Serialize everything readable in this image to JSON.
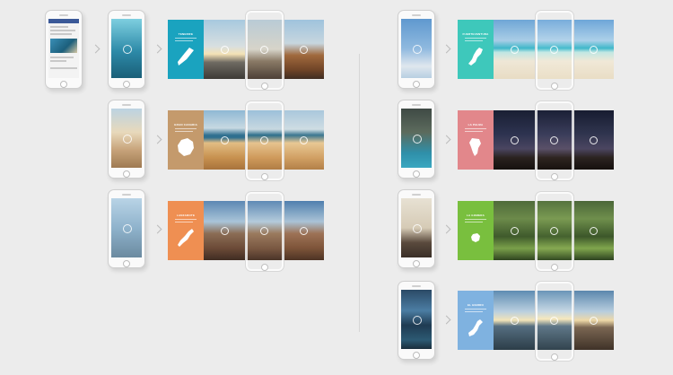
{
  "island_panels": {
    "tenerife": {
      "title": "TENERIFE",
      "color": "#1aa3bf"
    },
    "gran_canaria": {
      "title": "GRAN CANARIA",
      "color": "#c49a6c"
    },
    "lanzarote": {
      "title": "LANZAROTE",
      "color": "#ef8f52"
    },
    "fuerteventura": {
      "title": "FUERTEVENTURA",
      "color": "#3ec8bb"
    },
    "la_palma": {
      "title": "LA PALMA",
      "color": "#e2878b"
    },
    "la_gomera": {
      "title": "LA GOMERA",
      "color": "#79bf3e"
    },
    "el_hierro": {
      "title": "EL HIERRO",
      "color": "#7fb2e0"
    }
  },
  "colors": {
    "background": "#ececec",
    "divider": "#d6d6d6",
    "facebook_blue": "#3b5998"
  },
  "icons": {
    "phone": "smartphone-icon",
    "rotate": "tilt-icon",
    "arrow": "chevron-right-icon",
    "island": "island-silhouette-icon"
  }
}
